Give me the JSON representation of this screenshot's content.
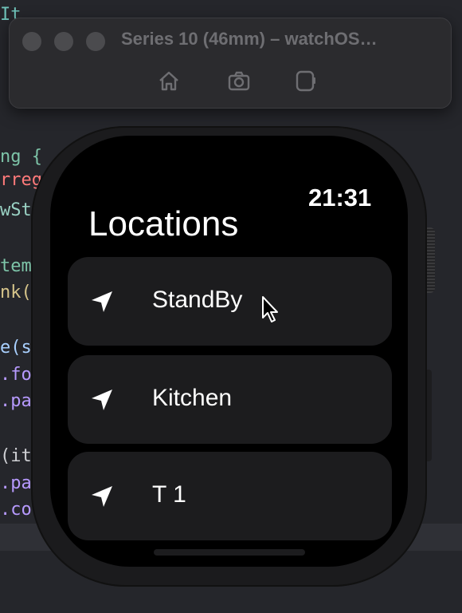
{
  "simulator": {
    "title": "Series 10 (46mm) – watchOS…",
    "toolbar": {
      "home": "home-icon",
      "screenshot": "camera-icon",
      "rotate": "rotate-icon"
    }
  },
  "watch": {
    "time": "21:31",
    "title": "Locations",
    "locations": [
      {
        "label": "StandBy"
      },
      {
        "label": "Kitchen"
      },
      {
        "label": "T 1"
      }
    ]
  },
  "colors": {
    "background": "#25262b",
    "screen": "#000000",
    "row": "#1c1c1e",
    "text": "#ffffff"
  }
}
